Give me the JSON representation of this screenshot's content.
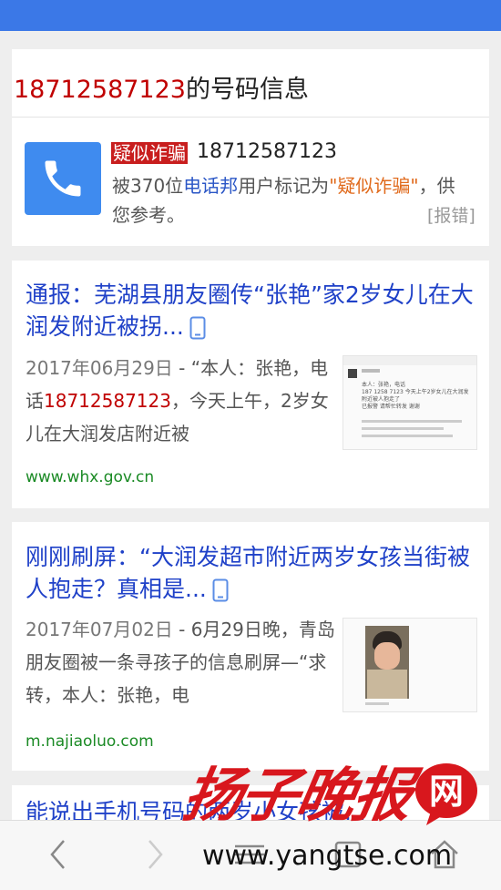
{
  "status_bar": {
    "color": "#3b78e7"
  },
  "number_card": {
    "title_number": "18712587123",
    "title_suffix": "的号码信息",
    "tag": "疑似诈骗",
    "tag_number": "18712587123",
    "mark_prefix": "被370位",
    "mark_app": "电话邦",
    "mark_middle": "用户标记为",
    "mark_label": "\"疑似诈骗\"",
    "mark_suffix": "，供您参考。",
    "report_link": "[报错]",
    "icon": "phone-icon"
  },
  "results": [
    {
      "title": "通报：芜湖县朋友圈传“张艳”家2岁女儿在大润发附近被拐...",
      "date": "2017年06月29日",
      "snippet_a": " - “本人：张艳，电话",
      "snippet_red": "18712587123",
      "snippet_b": "，今天上午，2岁女儿在大润发店附近被",
      "url": "www.whx.gov.cn",
      "icon": "mobile-icon",
      "thumb": {
        "line1": "本人：张艳，电话",
        "line2": "187 1258 7123 今天上午2岁女儿在大润发附近被人抱走了",
        "line3": "已报警 请帮忙转发 谢谢"
      }
    },
    {
      "title": "刚刚刷屏：“大润发超市附近两岁女孩当街被人抱走？真相是...",
      "date": "2017年07月02日",
      "snippet_a": " - 6月29日晚，青岛朋友圈被一条寻孩子的信息刷屏—“求转，本人：张艳，电",
      "url": "m.najiaoluo.com",
      "icon": "mobile-icon"
    },
    {
      "title": "能说出手机号码的两岁小女孩被..."
    }
  ],
  "bottom_nav": [
    "back-icon",
    "forward-icon",
    "menu-icon",
    "tabs-icon",
    "home-icon"
  ],
  "watermark": {
    "brand": "扬子晚报",
    "badge": "网",
    "url": "www.yangtse.com"
  }
}
